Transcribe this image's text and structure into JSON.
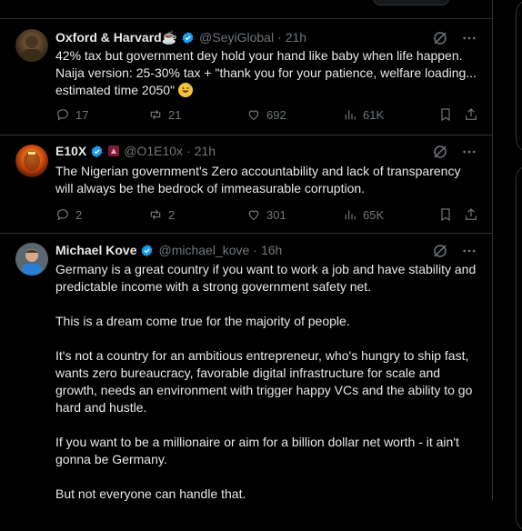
{
  "tweets": [
    {
      "name": "Oxford & Harvard☕",
      "handle": "@SeyiGlobal",
      "time": "21h",
      "text": "42% tax but government dey hold your hand like baby when life happen. Naija version: 25-30% tax + \"thank you for your patience, welfare loading... estimated time 2050\"",
      "replies": "17",
      "reposts": "21",
      "likes": "692",
      "views": "61K"
    },
    {
      "name": "E10X",
      "handle": "@O1E10x",
      "time": "21h",
      "text": "The Nigerian government's Zero accountability and lack of transparency will always be the bedrock of immeasurable corruption.",
      "replies": "2",
      "reposts": "2",
      "likes": "301",
      "views": "65K"
    },
    {
      "name": "Michael Kove",
      "handle": "@michael_kove",
      "time": "16h",
      "paragraphs": [
        "Germany is a great country if you want to work a job and have stability and predictable income with a strong government safety net.",
        "This is a dream come true for the majority of people.",
        "It's not a country for an ambitious entrepreneur, who's hungry to ship fast, wants zero bureaucracy, favorable digital infrastructure for scale and growth, needs an environment with trigger happy VCs and the ability to go hard and hustle.",
        "If you want to be a millionaire or aim for a billion dollar net worth - it ain't gonna be Germany.",
        "But not everyone can handle that."
      ]
    }
  ],
  "separator": "·",
  "colors": {
    "background": "#000000",
    "text": "#e7e9ea",
    "muted": "#71767b",
    "verified": "#1d9bf0",
    "border": "#2f3336"
  }
}
